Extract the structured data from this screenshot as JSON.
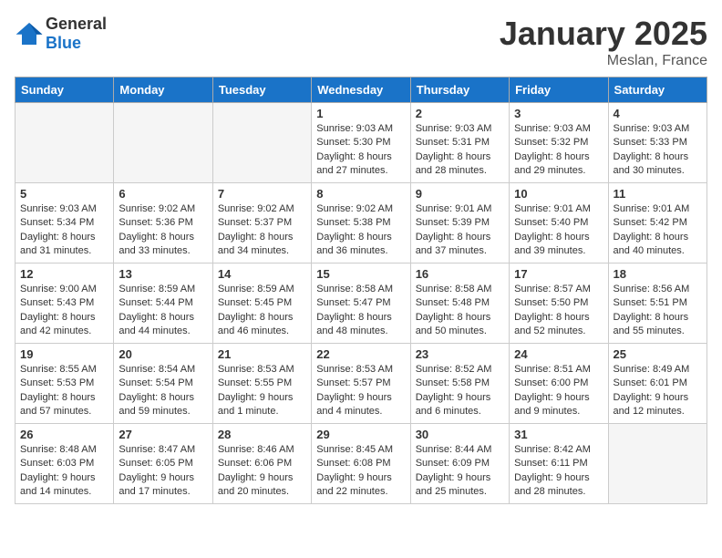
{
  "header": {
    "logo_general": "General",
    "logo_blue": "Blue",
    "month": "January 2025",
    "location": "Meslan, France"
  },
  "weekdays": [
    "Sunday",
    "Monday",
    "Tuesday",
    "Wednesday",
    "Thursday",
    "Friday",
    "Saturday"
  ],
  "weeks": [
    [
      {
        "day": "",
        "content": ""
      },
      {
        "day": "",
        "content": ""
      },
      {
        "day": "",
        "content": ""
      },
      {
        "day": "1",
        "content": "Sunrise: 9:03 AM\nSunset: 5:30 PM\nDaylight: 8 hours and 27 minutes."
      },
      {
        "day": "2",
        "content": "Sunrise: 9:03 AM\nSunset: 5:31 PM\nDaylight: 8 hours and 28 minutes."
      },
      {
        "day": "3",
        "content": "Sunrise: 9:03 AM\nSunset: 5:32 PM\nDaylight: 8 hours and 29 minutes."
      },
      {
        "day": "4",
        "content": "Sunrise: 9:03 AM\nSunset: 5:33 PM\nDaylight: 8 hours and 30 minutes."
      }
    ],
    [
      {
        "day": "5",
        "content": "Sunrise: 9:03 AM\nSunset: 5:34 PM\nDaylight: 8 hours and 31 minutes."
      },
      {
        "day": "6",
        "content": "Sunrise: 9:02 AM\nSunset: 5:36 PM\nDaylight: 8 hours and 33 minutes."
      },
      {
        "day": "7",
        "content": "Sunrise: 9:02 AM\nSunset: 5:37 PM\nDaylight: 8 hours and 34 minutes."
      },
      {
        "day": "8",
        "content": "Sunrise: 9:02 AM\nSunset: 5:38 PM\nDaylight: 8 hours and 36 minutes."
      },
      {
        "day": "9",
        "content": "Sunrise: 9:01 AM\nSunset: 5:39 PM\nDaylight: 8 hours and 37 minutes."
      },
      {
        "day": "10",
        "content": "Sunrise: 9:01 AM\nSunset: 5:40 PM\nDaylight: 8 hours and 39 minutes."
      },
      {
        "day": "11",
        "content": "Sunrise: 9:01 AM\nSunset: 5:42 PM\nDaylight: 8 hours and 40 minutes."
      }
    ],
    [
      {
        "day": "12",
        "content": "Sunrise: 9:00 AM\nSunset: 5:43 PM\nDaylight: 8 hours and 42 minutes."
      },
      {
        "day": "13",
        "content": "Sunrise: 8:59 AM\nSunset: 5:44 PM\nDaylight: 8 hours and 44 minutes."
      },
      {
        "day": "14",
        "content": "Sunrise: 8:59 AM\nSunset: 5:45 PM\nDaylight: 8 hours and 46 minutes."
      },
      {
        "day": "15",
        "content": "Sunrise: 8:58 AM\nSunset: 5:47 PM\nDaylight: 8 hours and 48 minutes."
      },
      {
        "day": "16",
        "content": "Sunrise: 8:58 AM\nSunset: 5:48 PM\nDaylight: 8 hours and 50 minutes."
      },
      {
        "day": "17",
        "content": "Sunrise: 8:57 AM\nSunset: 5:50 PM\nDaylight: 8 hours and 52 minutes."
      },
      {
        "day": "18",
        "content": "Sunrise: 8:56 AM\nSunset: 5:51 PM\nDaylight: 8 hours and 55 minutes."
      }
    ],
    [
      {
        "day": "19",
        "content": "Sunrise: 8:55 AM\nSunset: 5:53 PM\nDaylight: 8 hours and 57 minutes."
      },
      {
        "day": "20",
        "content": "Sunrise: 8:54 AM\nSunset: 5:54 PM\nDaylight: 8 hours and 59 minutes."
      },
      {
        "day": "21",
        "content": "Sunrise: 8:53 AM\nSunset: 5:55 PM\nDaylight: 9 hours and 1 minute."
      },
      {
        "day": "22",
        "content": "Sunrise: 8:53 AM\nSunset: 5:57 PM\nDaylight: 9 hours and 4 minutes."
      },
      {
        "day": "23",
        "content": "Sunrise: 8:52 AM\nSunset: 5:58 PM\nDaylight: 9 hours and 6 minutes."
      },
      {
        "day": "24",
        "content": "Sunrise: 8:51 AM\nSunset: 6:00 PM\nDaylight: 9 hours and 9 minutes."
      },
      {
        "day": "25",
        "content": "Sunrise: 8:49 AM\nSunset: 6:01 PM\nDaylight: 9 hours and 12 minutes."
      }
    ],
    [
      {
        "day": "26",
        "content": "Sunrise: 8:48 AM\nSunset: 6:03 PM\nDaylight: 9 hours and 14 minutes."
      },
      {
        "day": "27",
        "content": "Sunrise: 8:47 AM\nSunset: 6:05 PM\nDaylight: 9 hours and 17 minutes."
      },
      {
        "day": "28",
        "content": "Sunrise: 8:46 AM\nSunset: 6:06 PM\nDaylight: 9 hours and 20 minutes."
      },
      {
        "day": "29",
        "content": "Sunrise: 8:45 AM\nSunset: 6:08 PM\nDaylight: 9 hours and 22 minutes."
      },
      {
        "day": "30",
        "content": "Sunrise: 8:44 AM\nSunset: 6:09 PM\nDaylight: 9 hours and 25 minutes."
      },
      {
        "day": "31",
        "content": "Sunrise: 8:42 AM\nSunset: 6:11 PM\nDaylight: 9 hours and 28 minutes."
      },
      {
        "day": "",
        "content": ""
      }
    ]
  ]
}
